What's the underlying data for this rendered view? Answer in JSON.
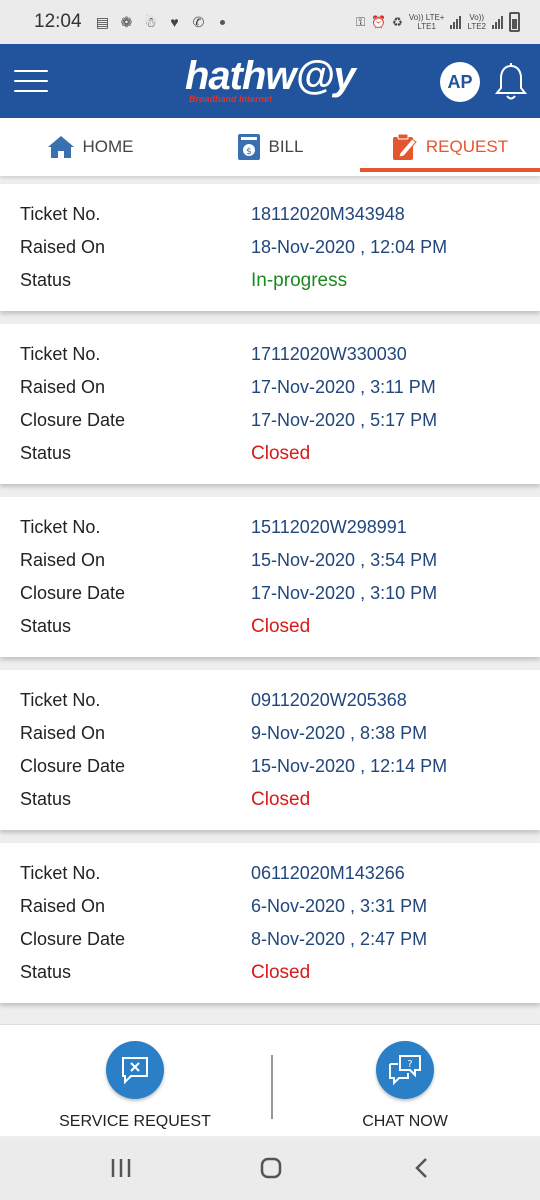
{
  "status_bar": {
    "time": "12:04",
    "left_icons": [
      "notes-icon",
      "settings-app-icon",
      "app-icon",
      "health-icon",
      "whatsapp-icon"
    ],
    "right_icons": [
      "key-icon",
      "alarm-icon",
      "battery-saver-icon"
    ],
    "sim1_label": "Vo)) LTE+",
    "sim1_sub": "LTE1",
    "sim2_label": "Vo))",
    "sim2_sub": "LTE2"
  },
  "header": {
    "logo_text": "hathw@y",
    "logo_tagline": "Broadband Internet",
    "avatar_initials": "AP"
  },
  "tabs": [
    {
      "label": "HOME",
      "icon": "home-icon",
      "active": false
    },
    {
      "label": "BILL",
      "icon": "bill-icon",
      "active": false
    },
    {
      "label": "REQUEST",
      "icon": "request-icon",
      "active": true
    }
  ],
  "labels": {
    "ticket_no": "Ticket No.",
    "raised_on": "Raised On",
    "closure_date": "Closure Date",
    "status": "Status"
  },
  "tickets": [
    {
      "ticket_no": "18112020M343948",
      "raised_on": "18-Nov-2020 , 12:04 PM",
      "closure_date": "",
      "status": "In-progress"
    },
    {
      "ticket_no": "17112020W330030",
      "raised_on": "17-Nov-2020 , 3:11 PM",
      "closure_date": "17-Nov-2020 , 5:17 PM",
      "status": "Closed"
    },
    {
      "ticket_no": "15112020W298991",
      "raised_on": "15-Nov-2020 , 3:54 PM",
      "closure_date": "17-Nov-2020 , 3:10 PM",
      "status": "Closed"
    },
    {
      "ticket_no": "09112020W205368",
      "raised_on": "9-Nov-2020 , 8:38 PM",
      "closure_date": "15-Nov-2020 , 12:14 PM",
      "status": "Closed"
    },
    {
      "ticket_no": "06112020M143266",
      "raised_on": "6-Nov-2020 , 3:31 PM",
      "closure_date": "8-Nov-2020 , 2:47 PM",
      "status": "Closed"
    }
  ],
  "actions": {
    "service_request": "SERVICE REQUEST",
    "chat_now": "CHAT NOW"
  },
  "colors": {
    "brand_blue": "#21549c",
    "accent_orange": "#e4572e",
    "in_progress": "#1a8a20",
    "closed": "#d91a1a",
    "action_blue": "#2a7fc7"
  }
}
